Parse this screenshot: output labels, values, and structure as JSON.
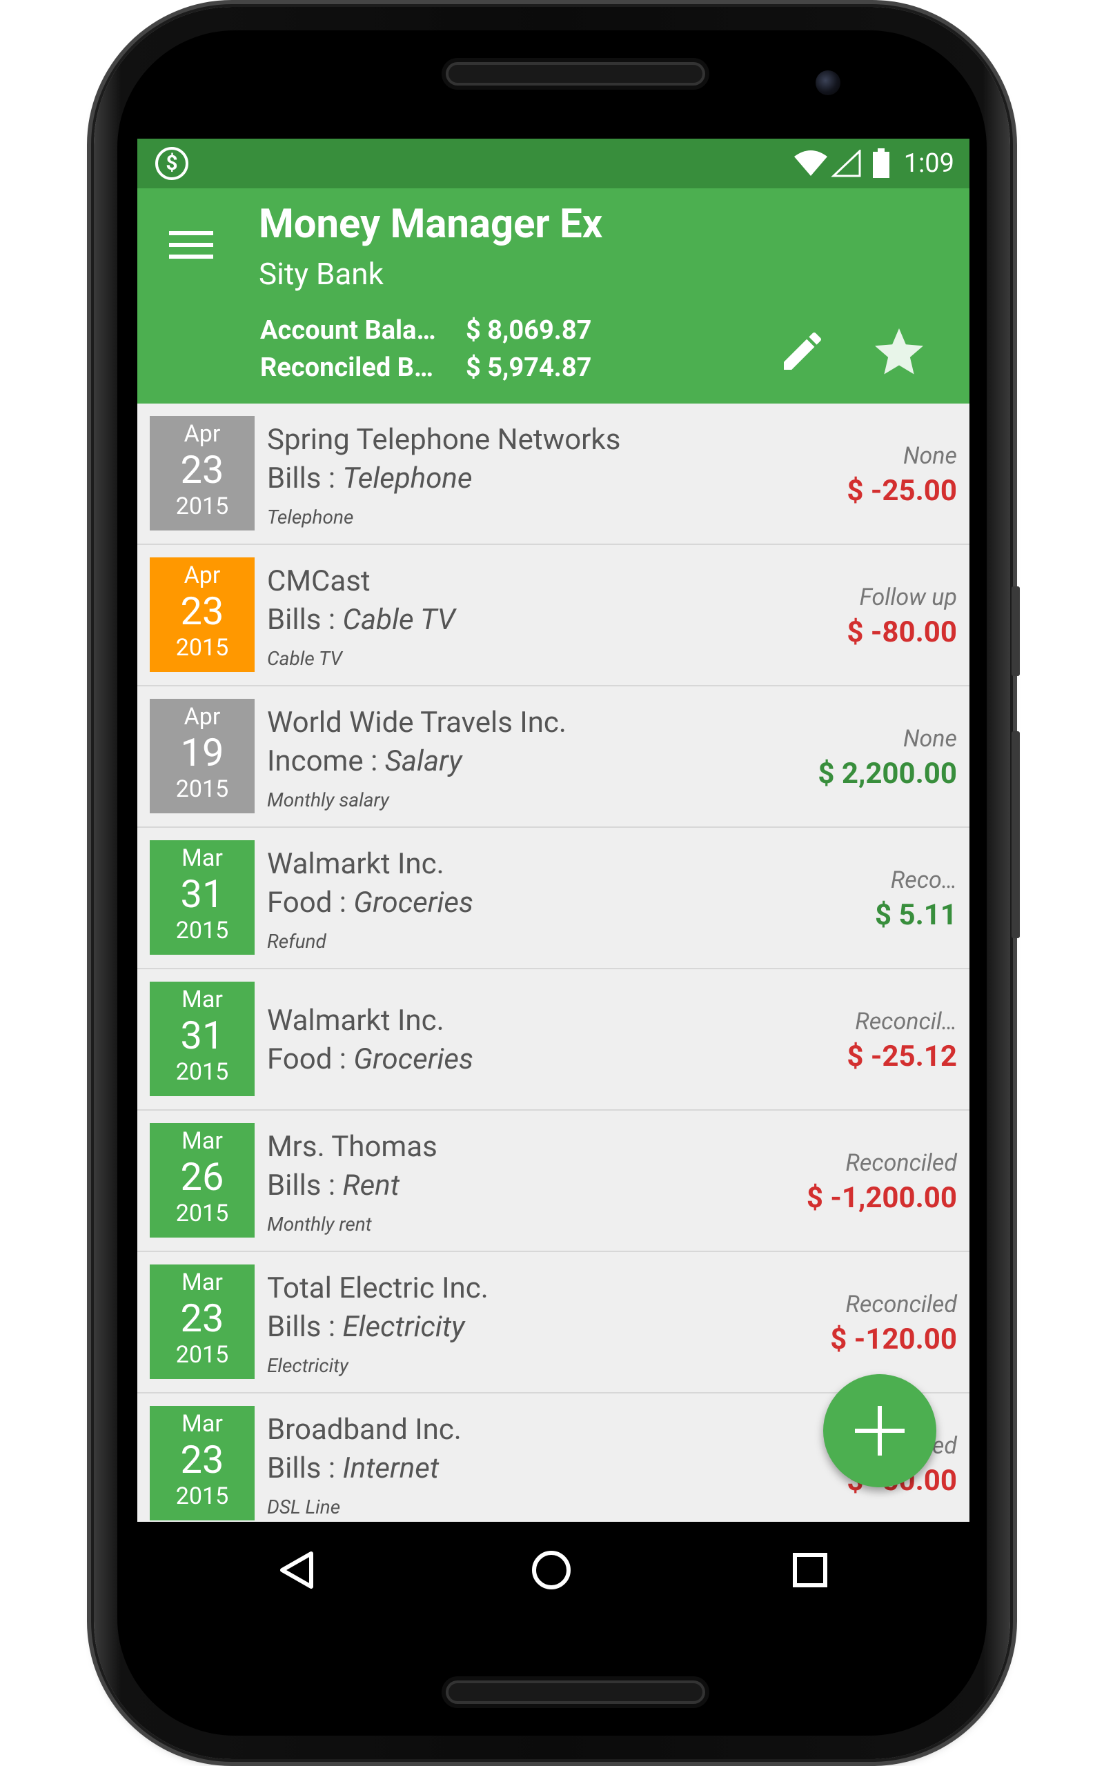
{
  "colors": {
    "status_bar": "#388e3c",
    "app_bar": "#4caf50",
    "positive_amount": "#388e3c",
    "negative_amount": "#d32f2f",
    "date_reconciled": "#4caf50",
    "date_none": "#9e9e9e",
    "date_followup": "#ff9800"
  },
  "status_bar": {
    "time": "1:09",
    "left_icon": "dollar-circle-icon",
    "icons": [
      "wifi-icon",
      "cell-signal-icon",
      "battery-icon"
    ]
  },
  "app_bar": {
    "title": "Money Manager Ex",
    "subtitle": "Sity Bank",
    "account_balance_label": "Account Bala…",
    "account_balance_value": "$ 8,069.87",
    "reconciled_balance_label": "Reconciled B…",
    "reconciled_balance_value": "$ 5,974.87",
    "actions": [
      "menu-icon",
      "edit-icon",
      "star-icon"
    ]
  },
  "transactions": [
    {
      "month": "Apr",
      "day": "23",
      "year": "2015",
      "payee": "Spring Telephone Networks",
      "category": "Bills",
      "subcategory": "Telephone",
      "notes": "Telephone",
      "status": "None",
      "amount": "$ -25.00",
      "sign": "negative",
      "date_color": "#9e9e9e"
    },
    {
      "month": "Apr",
      "day": "23",
      "year": "2015",
      "payee": "CMCast",
      "category": "Bills",
      "subcategory": "Cable TV",
      "notes": "Cable TV",
      "status": "Follow up",
      "amount": "$ -80.00",
      "sign": "negative",
      "date_color": "#ff9800"
    },
    {
      "month": "Apr",
      "day": "19",
      "year": "2015",
      "payee": "World Wide Travels Inc.",
      "category": "Income",
      "subcategory": "Salary",
      "notes": "Monthly salary",
      "status": "None",
      "amount": "$ 2,200.00",
      "sign": "positive",
      "date_color": "#9e9e9e"
    },
    {
      "month": "Mar",
      "day": "31",
      "year": "2015",
      "payee": "Walmarkt Inc.",
      "category": "Food",
      "subcategory": "Groceries",
      "notes": "Refund",
      "status": "Reco…",
      "amount": "$ 5.11",
      "sign": "positive",
      "date_color": "#4caf50"
    },
    {
      "month": "Mar",
      "day": "31",
      "year": "2015",
      "payee": "Walmarkt Inc.",
      "category": "Food",
      "subcategory": "Groceries",
      "notes": "",
      "status": "Reconcil…",
      "amount": "$ -25.12",
      "sign": "negative",
      "date_color": "#4caf50"
    },
    {
      "month": "Mar",
      "day": "26",
      "year": "2015",
      "payee": "Mrs. Thomas",
      "category": "Bills",
      "subcategory": "Rent",
      "notes": "Monthly rent",
      "status": "Reconciled",
      "amount": "$ -1,200.00",
      "sign": "negative",
      "date_color": "#4caf50"
    },
    {
      "month": "Mar",
      "day": "23",
      "year": "2015",
      "payee": "Total Electric Inc.",
      "category": "Bills",
      "subcategory": "Electricity",
      "notes": "Electricity",
      "status": "Reconciled",
      "amount": "$ -120.00",
      "sign": "negative",
      "date_color": "#4caf50"
    },
    {
      "month": "Mar",
      "day": "23",
      "year": "2015",
      "payee": "Broadband Inc.",
      "category": "Bills",
      "subcategory": "Internet",
      "notes": "DSL Line",
      "status": "Reconciled",
      "amount": "$ -50.00",
      "sign": "negative",
      "date_color": "#4caf50"
    }
  ],
  "fab": {
    "icon": "plus-icon"
  },
  "nav_bar": {
    "icons": [
      "back-icon",
      "home-icon",
      "recent-apps-icon"
    ]
  }
}
